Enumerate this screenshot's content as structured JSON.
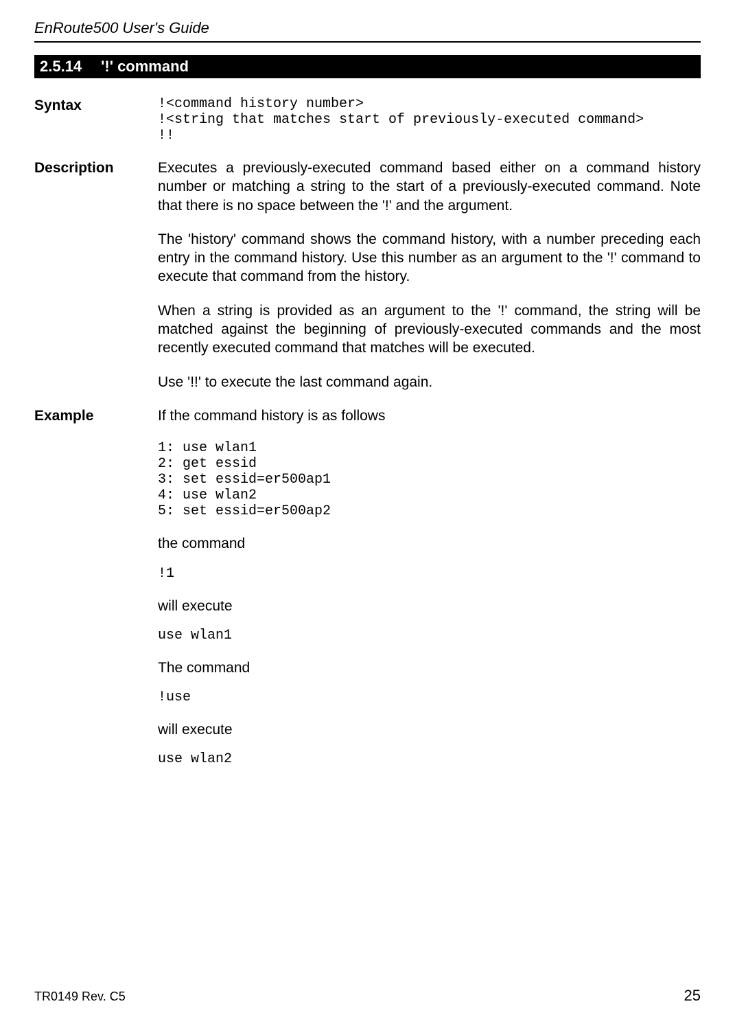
{
  "header": {
    "running_title": "EnRoute500 User's Guide"
  },
  "section": {
    "number": "2.5.14",
    "title": "'!' command"
  },
  "rows": {
    "syntax_label": "Syntax",
    "syntax_code": "!<command history number>\n!<string that matches start of previously-executed command>\n!!",
    "description_label": "Description",
    "description_p1": "Executes a previously-executed command based either on a command history number or matching a string to the start of a previously-executed command. Note that there is no space between the '!' and the argument.",
    "description_p2": "The 'history' command shows the command history, with a number preceding each entry in the command history. Use this number as an argument to the '!' command to execute that command from the history.",
    "description_p3": "When a string is provided as an argument to the '!' command, the string will be matched against the beginning of previously-executed commands and the most recently executed command that matches will be executed.",
    "description_p4": "Use '!!' to execute the last command again.",
    "example_label": "Example",
    "example_intro": "If the command history is as follows",
    "example_history": "1: use wlan1\n2: get essid\n3: set essid=er500ap1\n4: use wlan2\n5: set essid=er500ap2",
    "example_t1": "the command",
    "example_c1": "!1",
    "example_t2": "will execute",
    "example_c2": "use wlan1",
    "example_t3": "The command",
    "example_c3": "!use",
    "example_t4": "will execute",
    "example_c4": "use wlan2"
  },
  "footer": {
    "doc_rev": "TR0149 Rev. C5",
    "page_number": "25"
  }
}
